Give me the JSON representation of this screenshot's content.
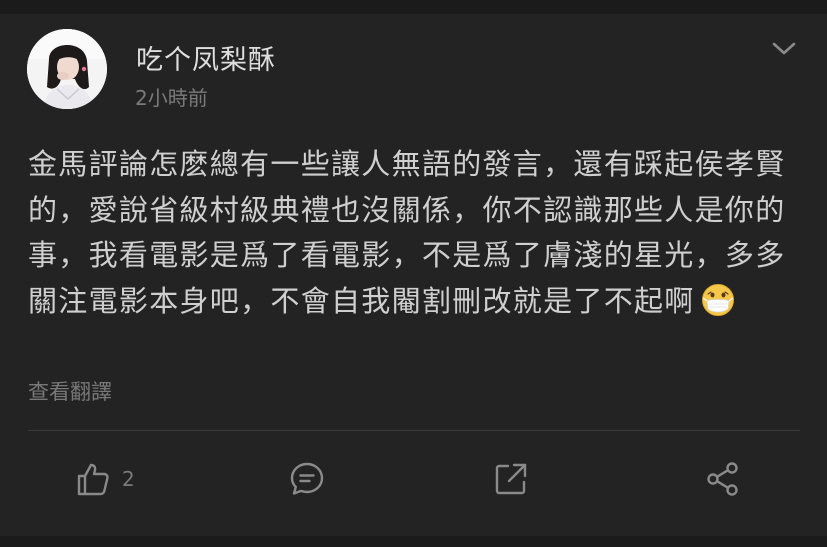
{
  "post": {
    "author": "吃个凤梨酥",
    "time": "2小時前",
    "text": "金馬評論怎麽總有一些讓人無語的發言，還有踩起侯孝賢的，愛說省級村級典禮也沒關係，你不認識那些人是你的事，我看電影是爲了看電影，不是爲了膚淺的星光，多多關注電影本身吧，不會自我閹割刪改就是了不起啊",
    "emoji": "mask-face-emoji",
    "translate_label": "查看翻譯"
  },
  "actions": {
    "like_count": "2",
    "like_icon": "thumbs-up-icon",
    "comment_icon": "comment-icon",
    "repost_icon": "repost-icon",
    "share_icon": "share-icon"
  },
  "menu_icon": "chevron-down-icon",
  "colors": {
    "background": "#151515",
    "card": "#232323",
    "text_primary": "#cfcfcf",
    "text_secondary": "#7a7a7a",
    "icon": "#8a8a8a"
  }
}
